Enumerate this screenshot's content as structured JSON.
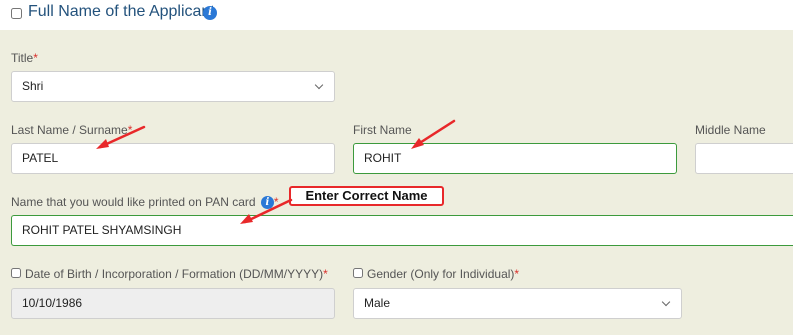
{
  "section": {
    "title": "Full Name of the Applicant",
    "info_icon": "i"
  },
  "form": {
    "title_label": "Title",
    "title_value": "Shri",
    "last_name_label": "Last Name / Surname",
    "last_name_value": "PATEL",
    "first_name_label": "First Name",
    "first_name_value": "ROHIT",
    "middle_name_label": "Middle Name",
    "middle_name_value": "",
    "pan_name_label": "Name that you would like printed on PAN card",
    "pan_name_value": "ROHIT PATEL SHYAMSINGH",
    "dob_label": "Date of Birth / Incorporation / Formation (DD/MM/YYYY)",
    "dob_value": "10/10/1986",
    "gender_label": "Gender (Only for Individual)",
    "gender_value": "Male",
    "required_mark": "*"
  },
  "annotation": {
    "callout_text": "Enter Correct Name",
    "color": "#e8282a"
  },
  "colors": {
    "panel_bg": "#eeeedf",
    "valid_border": "#3c9a3c",
    "info_blue": "#2a78d6",
    "heading_blue": "#23527c"
  }
}
